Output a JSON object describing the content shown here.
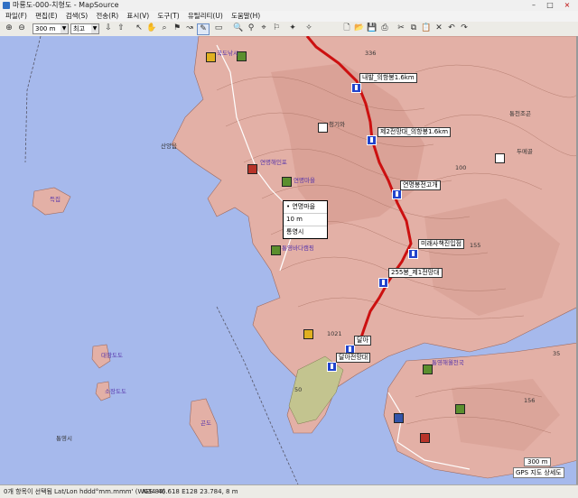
{
  "window": {
    "title": "마룡도-000-치형도 - MapSource",
    "min": "–",
    "max": "□",
    "close": "×"
  },
  "menu": [
    "파일(F)",
    "편집(E)",
    "검색(S)",
    "전송(R)",
    "표시(V)",
    "도구(T)",
    "유틸리티(U)",
    "도움말(H)"
  ],
  "toolbar": {
    "zoom_value": "300 m",
    "detail_value": "최고"
  },
  "map": {
    "waypoints": [
      "내발_의항봉1.6km",
      "제2전망대_의항봉1.6km",
      "연명봉전고개",
      "미래사책진입점",
      "255봉_제1전망대",
      "달아",
      "달아전망대"
    ],
    "popup": [
      "연명마을",
      "10 m",
      "통영시"
    ],
    "places": [
      "산양읍",
      "득집",
      "대항도도",
      "소장도도",
      "곤도",
      "통영시",
      "통영해월천국",
      "통천조곤",
      "두메골",
      "청기와",
      "연명해인포",
      "국도낚시",
      "연명마을",
      "통영바다캠핑"
    ],
    "heights": [
      "336",
      "100",
      "1021",
      "50",
      "156",
      "155",
      "35"
    ],
    "scale_label": "300 m",
    "gps_label": "GPS 지도 상세도"
  },
  "status": {
    "selection": "0개 항목이 선택됨",
    "format": "Lat/Lon hddd°mm.mmm' (WGS 84)",
    "coords": "N34 46.618 E128 23.784, 8 m"
  }
}
